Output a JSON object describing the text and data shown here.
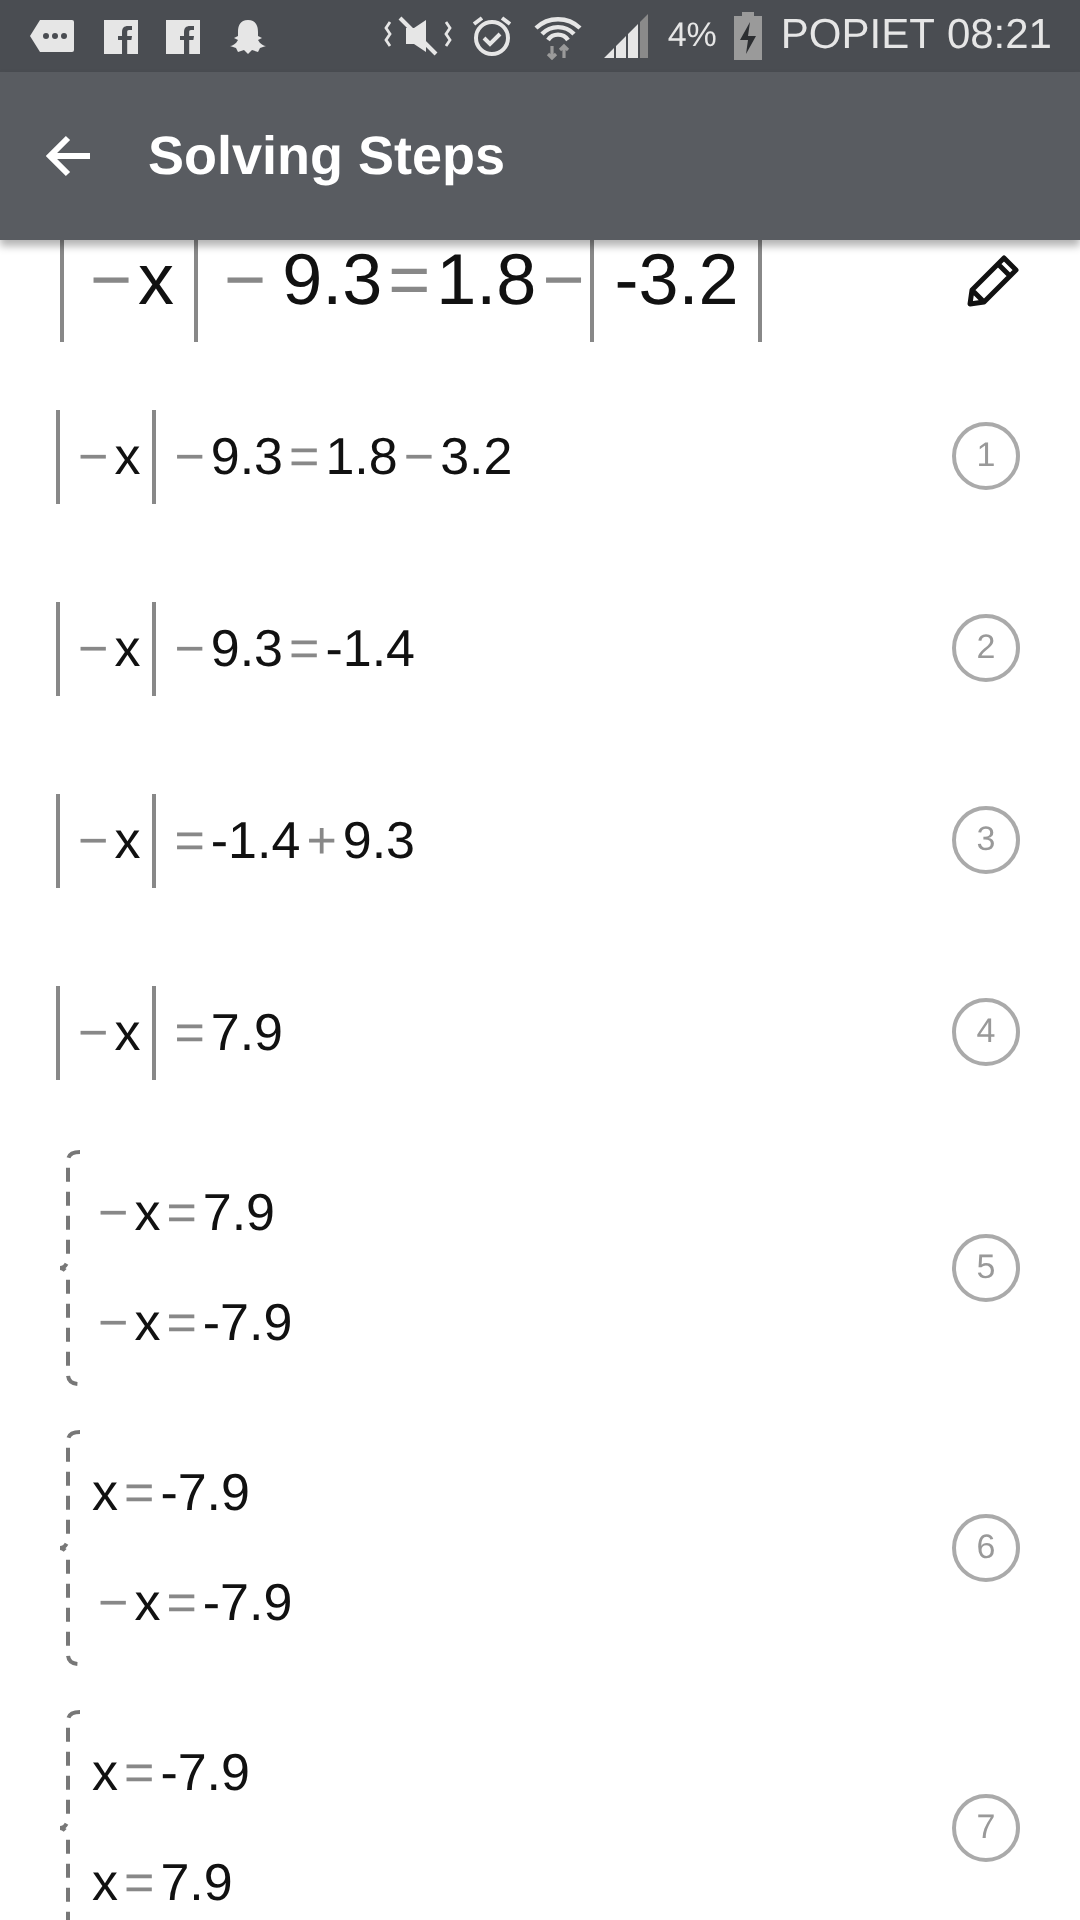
{
  "status_bar": {
    "battery": "4%",
    "carrier": "POPIET",
    "time": "08:21"
  },
  "header": {
    "title": "Solving Steps"
  },
  "problem": {
    "tokens": [
      {
        "kind": "abs",
        "parts": [
          {
            "kind": "op",
            "text": "−"
          },
          {
            "kind": "term",
            "text": "x"
          }
        ]
      },
      {
        "kind": "op",
        "text": "−"
      },
      {
        "kind": "term",
        "text": "9.3"
      },
      {
        "kind": "op",
        "text": "="
      },
      {
        "kind": "term",
        "text": "1.8"
      },
      {
        "kind": "op",
        "text": "−"
      },
      {
        "kind": "abs",
        "parts": [
          {
            "kind": "term",
            "text": "-3.2"
          }
        ]
      }
    ]
  },
  "steps": [
    {
      "number": "1",
      "kind": "line",
      "tokens": [
        {
          "kind": "abs",
          "parts": [
            {
              "kind": "op",
              "text": "−"
            },
            {
              "kind": "term",
              "text": "x"
            }
          ]
        },
        {
          "kind": "op",
          "text": "−"
        },
        {
          "kind": "term",
          "text": "9.3"
        },
        {
          "kind": "op",
          "text": "="
        },
        {
          "kind": "term",
          "text": "1.8"
        },
        {
          "kind": "op",
          "text": "−"
        },
        {
          "kind": "term",
          "text": "3.2"
        }
      ]
    },
    {
      "number": "2",
      "kind": "line",
      "tokens": [
        {
          "kind": "abs",
          "parts": [
            {
              "kind": "op",
              "text": "−"
            },
            {
              "kind": "term",
              "text": "x"
            }
          ]
        },
        {
          "kind": "op",
          "text": "−"
        },
        {
          "kind": "term",
          "text": "9.3"
        },
        {
          "kind": "op",
          "text": "="
        },
        {
          "kind": "term",
          "text": "-1.4"
        }
      ]
    },
    {
      "number": "3",
      "kind": "line",
      "tokens": [
        {
          "kind": "abs",
          "parts": [
            {
              "kind": "op",
              "text": "−"
            },
            {
              "kind": "term",
              "text": "x"
            }
          ]
        },
        {
          "kind": "op",
          "text": "="
        },
        {
          "kind": "term",
          "text": "-1.4"
        },
        {
          "kind": "op",
          "text": "+"
        },
        {
          "kind": "term",
          "text": "9.3"
        }
      ]
    },
    {
      "number": "4",
      "kind": "line",
      "tokens": [
        {
          "kind": "abs",
          "parts": [
            {
              "kind": "op",
              "text": "−"
            },
            {
              "kind": "term",
              "text": "x"
            }
          ]
        },
        {
          "kind": "op",
          "text": "="
        },
        {
          "kind": "term",
          "text": "7.9"
        }
      ]
    },
    {
      "number": "5",
      "kind": "system",
      "lines": [
        [
          {
            "kind": "op",
            "text": "−"
          },
          {
            "kind": "term",
            "text": "x"
          },
          {
            "kind": "op",
            "text": "="
          },
          {
            "kind": "term",
            "text": "7.9"
          }
        ],
        [
          {
            "kind": "op",
            "text": "−"
          },
          {
            "kind": "term",
            "text": "x"
          },
          {
            "kind": "op",
            "text": "="
          },
          {
            "kind": "term",
            "text": "-7.9"
          }
        ]
      ]
    },
    {
      "number": "6",
      "kind": "system",
      "lines": [
        [
          {
            "kind": "term",
            "text": "x"
          },
          {
            "kind": "op",
            "text": "="
          },
          {
            "kind": "term",
            "text": "-7.9"
          }
        ],
        [
          {
            "kind": "op",
            "text": "−"
          },
          {
            "kind": "term",
            "text": "x"
          },
          {
            "kind": "op",
            "text": "="
          },
          {
            "kind": "term",
            "text": "-7.9"
          }
        ]
      ]
    },
    {
      "number": "7",
      "kind": "system",
      "lines": [
        [
          {
            "kind": "term",
            "text": "x"
          },
          {
            "kind": "op",
            "text": "="
          },
          {
            "kind": "term",
            "text": "-7.9"
          }
        ],
        [
          {
            "kind": "term",
            "text": "x"
          },
          {
            "kind": "op",
            "text": "="
          },
          {
            "kind": "term",
            "text": "7.9"
          }
        ]
      ]
    }
  ]
}
